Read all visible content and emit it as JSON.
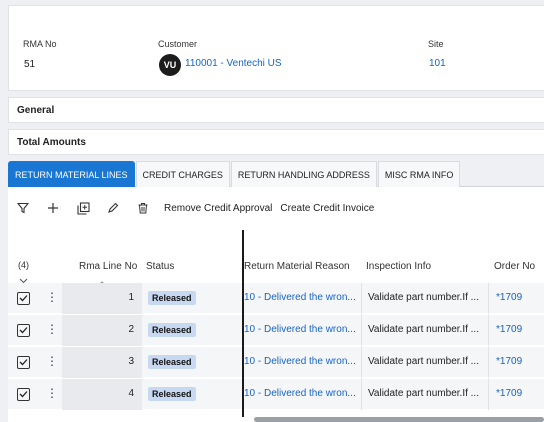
{
  "header": {
    "rma_no_label": "RMA No",
    "rma_no_value": "51",
    "customer_label": "Customer",
    "customer_avatar": "VU",
    "customer_value": "110001 - Ventechi US",
    "site_label": "Site",
    "site_value": "101"
  },
  "sections": {
    "general": "General",
    "total_amounts": "Total Amounts"
  },
  "tabs": [
    {
      "label": "RETURN MATERIAL LINES",
      "active": true
    },
    {
      "label": "CREDIT CHARGES",
      "active": false
    },
    {
      "label": "RETURN HANDLING ADDRESS",
      "active": false
    },
    {
      "label": "MISC RMA INFO",
      "active": false
    }
  ],
  "toolbar": {
    "icons": [
      "filter-icon",
      "add-icon",
      "duplicate-icon",
      "edit-icon",
      "delete-icon"
    ],
    "remove_credit_approval": "Remove Credit Approval",
    "create_credit_invoice": "Create Credit Invoice"
  },
  "grid": {
    "count": "(4)",
    "columns": {
      "rma_line_no": "Rma Line No",
      "status": "Status",
      "return_reason": "Return Material Reason",
      "inspection_info": "Inspection Info",
      "order_no": "Order No"
    },
    "rows": [
      {
        "line": "1",
        "status": "Released",
        "reason": "10 - Delivered the wron...",
        "inspection": "Validate part number.If ...",
        "order": "*1709"
      },
      {
        "line": "2",
        "status": "Released",
        "reason": "10 - Delivered the wron...",
        "inspection": "Validate part number.If ...",
        "order": "*1709"
      },
      {
        "line": "3",
        "status": "Released",
        "reason": "10 - Delivered the wron...",
        "inspection": "Validate part number.If ...",
        "order": "*1709"
      },
      {
        "line": "4",
        "status": "Released",
        "reason": "10 - Delivered the wron...",
        "inspection": "Validate part number.If ...",
        "order": "*1709"
      }
    ]
  },
  "colors": {
    "accent": "#1976d2",
    "link": "#1565c0",
    "badge_bg": "#c6d9f1"
  }
}
